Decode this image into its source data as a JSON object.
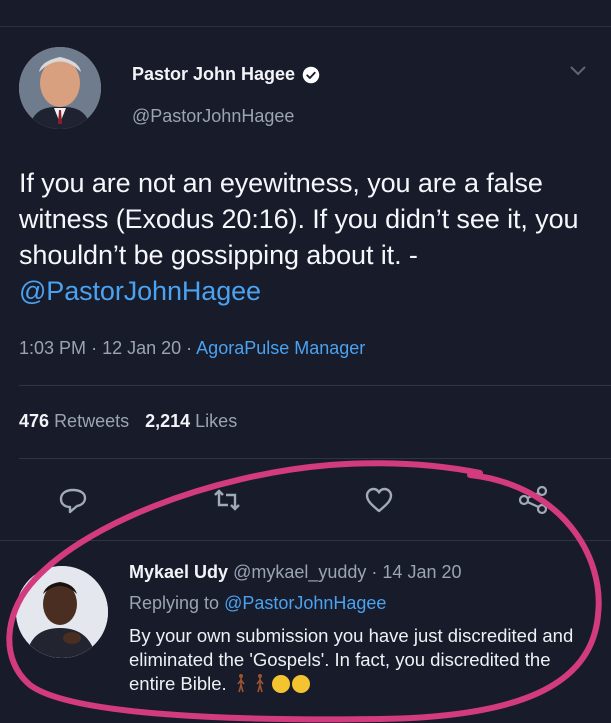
{
  "tweet": {
    "author_name": "Pastor John Hagee",
    "author_handle": "@PastorJohnHagee",
    "text_plain": "If you are not an eyewitness, you are a false witness (Exodus 20:16). If you didn’t see it, you shouldn’t be gossipping about it. - ",
    "text_mention": "@PastorJohnHagee",
    "time": "1:03 PM",
    "date": "12 Jan 20",
    "source": "AgoraPulse Manager",
    "retweets_count": "476",
    "retweets_label": "Retweets",
    "likes_count": "2,214",
    "likes_label": "Likes"
  },
  "reply": {
    "author_name": "Mykael Udy",
    "author_handle": "@mykael_yuddy",
    "date": "14 Jan 20",
    "replying_prefix": "Replying to",
    "replying_to": "@PastorJohnHagee",
    "text": "By your own submission you have just discredited and eliminated the 'Gospels'. In fact, you discredited the entire Bible."
  },
  "icons": {
    "verified": "verified-badge-icon",
    "chevron": "chevron-down-icon",
    "reply": "reply-icon",
    "retweet": "retweet-icon",
    "like": "heart-icon",
    "share": "share-icon"
  },
  "colors": {
    "background": "#171b2a",
    "link": "#4aa2f0",
    "secondary_text": "#9aa4b2",
    "annotation": "#d23b7f"
  }
}
